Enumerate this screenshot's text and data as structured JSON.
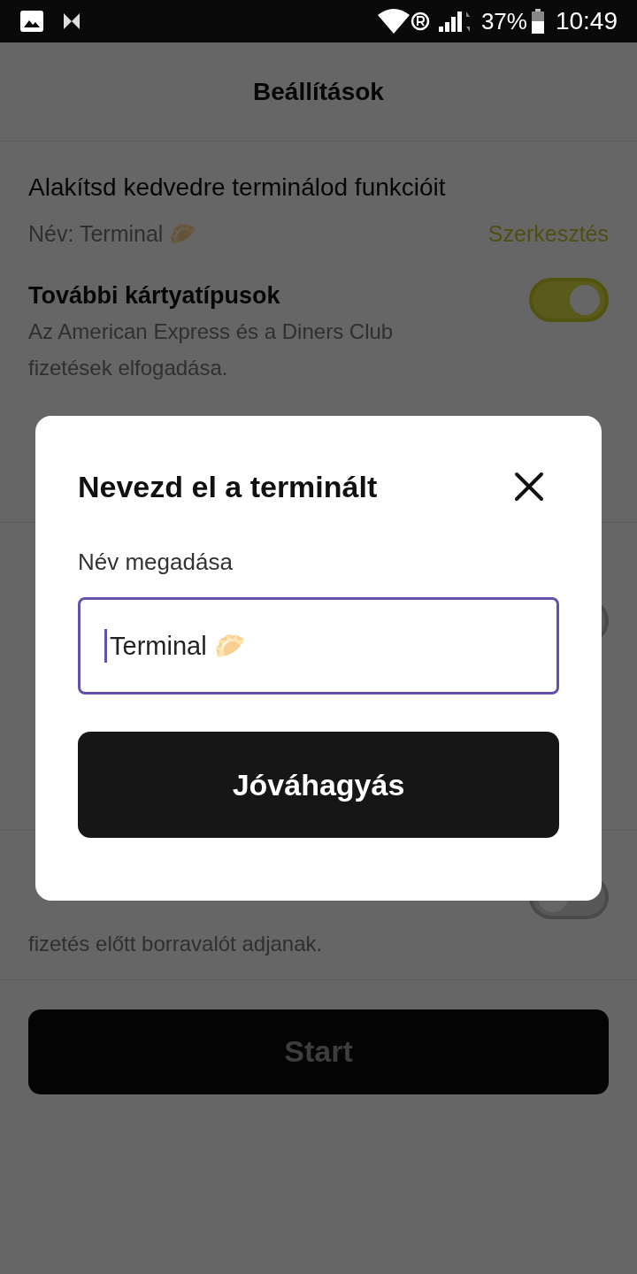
{
  "status_bar": {
    "battery": "37%",
    "time": "10:49"
  },
  "header": {
    "title": "Beállítások"
  },
  "settings": [
    {
      "kind": "name",
      "title": "Alakítsd kedvedre terminálod funkcióit",
      "name_label": "Név: Terminal 🥟",
      "action": "Szerkesztés"
    },
    {
      "kind": "toggle",
      "title": "További kártyatípusok",
      "description": "Az American Express és a Diners Club fizetések elfogadása.",
      "on": true
    },
    {
      "kind": "toggle",
      "on": false
    },
    {
      "kind": "toggle",
      "description": "fizetés előtt borravalót adjanak.",
      "on": false
    }
  ],
  "start_button": {
    "label": "Start",
    "disabled": true
  },
  "dialog": {
    "title": "Nevezd el a terminált",
    "field_label": "Név megadása",
    "value": "Terminal 🥟",
    "button": "Jóváhagyás"
  }
}
